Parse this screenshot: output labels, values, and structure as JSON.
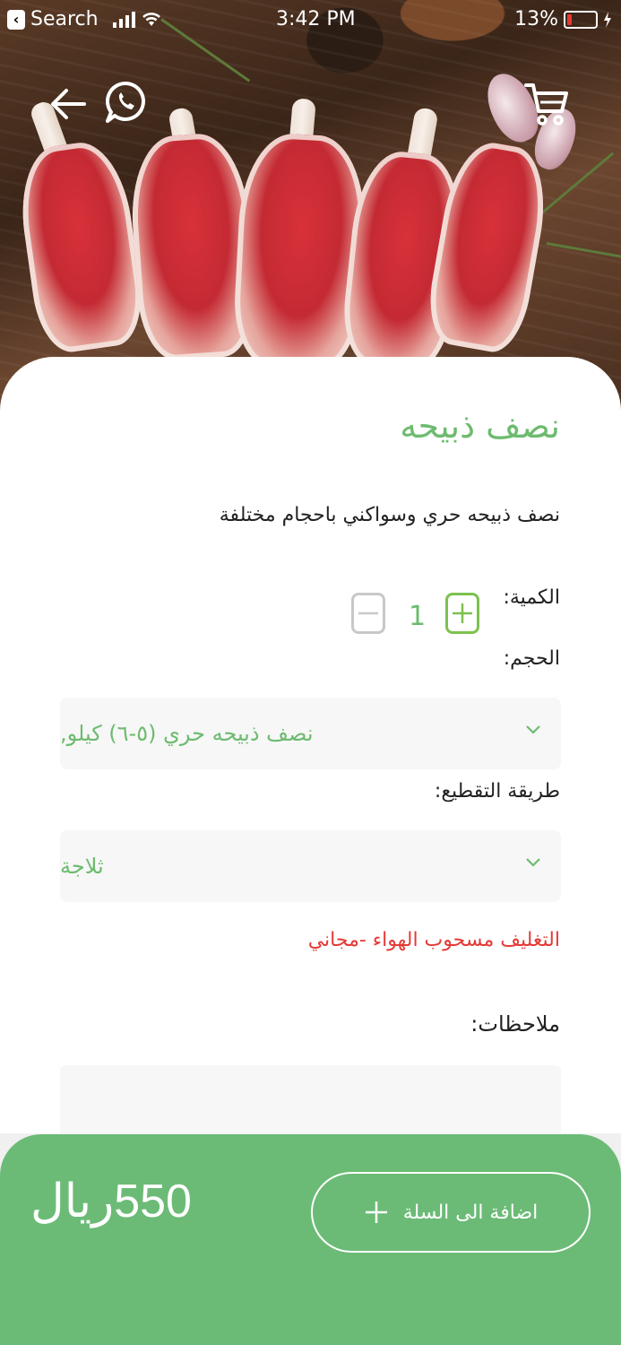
{
  "status_bar": {
    "back_app": "Search",
    "time": "3:42 PM",
    "battery": "13%"
  },
  "header": {
    "back_icon": "arrow-left-icon",
    "whatsapp_icon": "whatsapp-icon",
    "cart_icon": "cart-icon"
  },
  "product": {
    "title": "نصف ذبيحه",
    "description": "نصف ذبيحه حري وسواكني باحجام مختلفة"
  },
  "quantity": {
    "label": "الكمية:",
    "value": "1",
    "plus_icon": "plus-icon",
    "minus_icon": "minus-icon"
  },
  "size": {
    "label": "الحجم:",
    "selected": "نصف ذبيحه حري (٥-٦) كيلو,"
  },
  "cutting": {
    "label": "طريقة التقطيع:",
    "selected": "ثلاجة"
  },
  "packaging_note": "التغليف مسحوب الهواء -مجاني",
  "notes": {
    "label": "ملاحظات:",
    "value": ""
  },
  "footer": {
    "price": "550ريال",
    "add_to_cart_label": "اضافة الى السلة"
  },
  "colors": {
    "primary_green": "#6bbb76",
    "title_green": "#6dbb6f",
    "plus_green": "#7cc24e",
    "note_red": "#e53935"
  }
}
